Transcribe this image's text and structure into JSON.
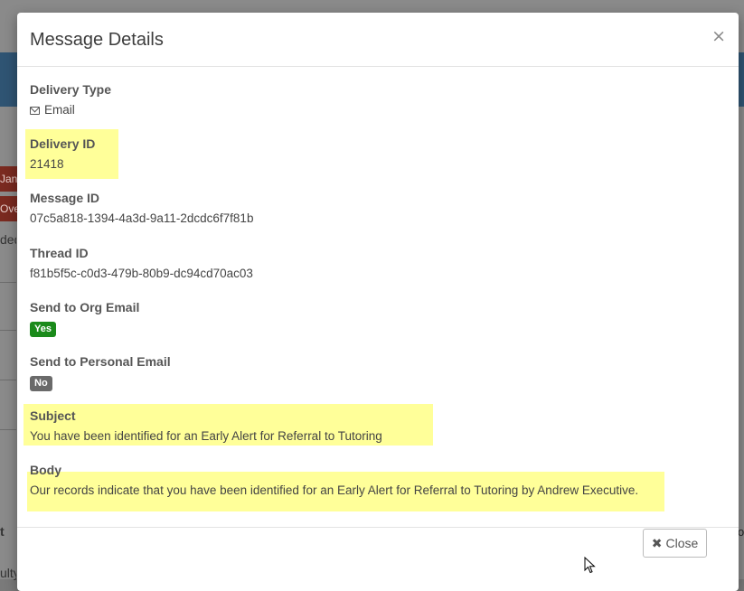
{
  "background": {
    "btn1_text": "Janua",
    "btn2_text": "Ove",
    "text1": "ded",
    "text2": "t",
    "text3": "ulty",
    "right_text": "o"
  },
  "modal": {
    "title": "Message Details",
    "close_symbol": "×",
    "fields": {
      "delivery_type": {
        "label": "Delivery Type",
        "value": "Email",
        "icon": "envelope-icon"
      },
      "delivery_id": {
        "label": "Delivery ID",
        "value": "21418"
      },
      "message_id": {
        "label": "Message ID",
        "value": "07c5a818-1394-4a3d-9a11-2dcdc6f7f81b"
      },
      "thread_id": {
        "label": "Thread ID",
        "value": "f81b5f5c-c0d3-479b-80b9-dc94cd70ac03"
      },
      "send_org": {
        "label": "Send to Org Email",
        "value": "Yes"
      },
      "send_personal": {
        "label": "Send to Personal Email",
        "value": "No"
      },
      "subject": {
        "label": "Subject",
        "value": "You have been identified for an Early Alert for Referral to Tutoring"
      },
      "body": {
        "label": "Body",
        "value": "Our records indicate that you have been identified for an Early Alert for Referral to Tutoring by Andrew Executive."
      }
    },
    "footer": {
      "close_label": "Close",
      "close_icon": "times-icon"
    }
  },
  "colors": {
    "highlight": "#ffff99",
    "badge_yes": "#1a8a1a",
    "badge_no": "#6a6a6a",
    "backdrop_band": "#1f4a6e"
  }
}
